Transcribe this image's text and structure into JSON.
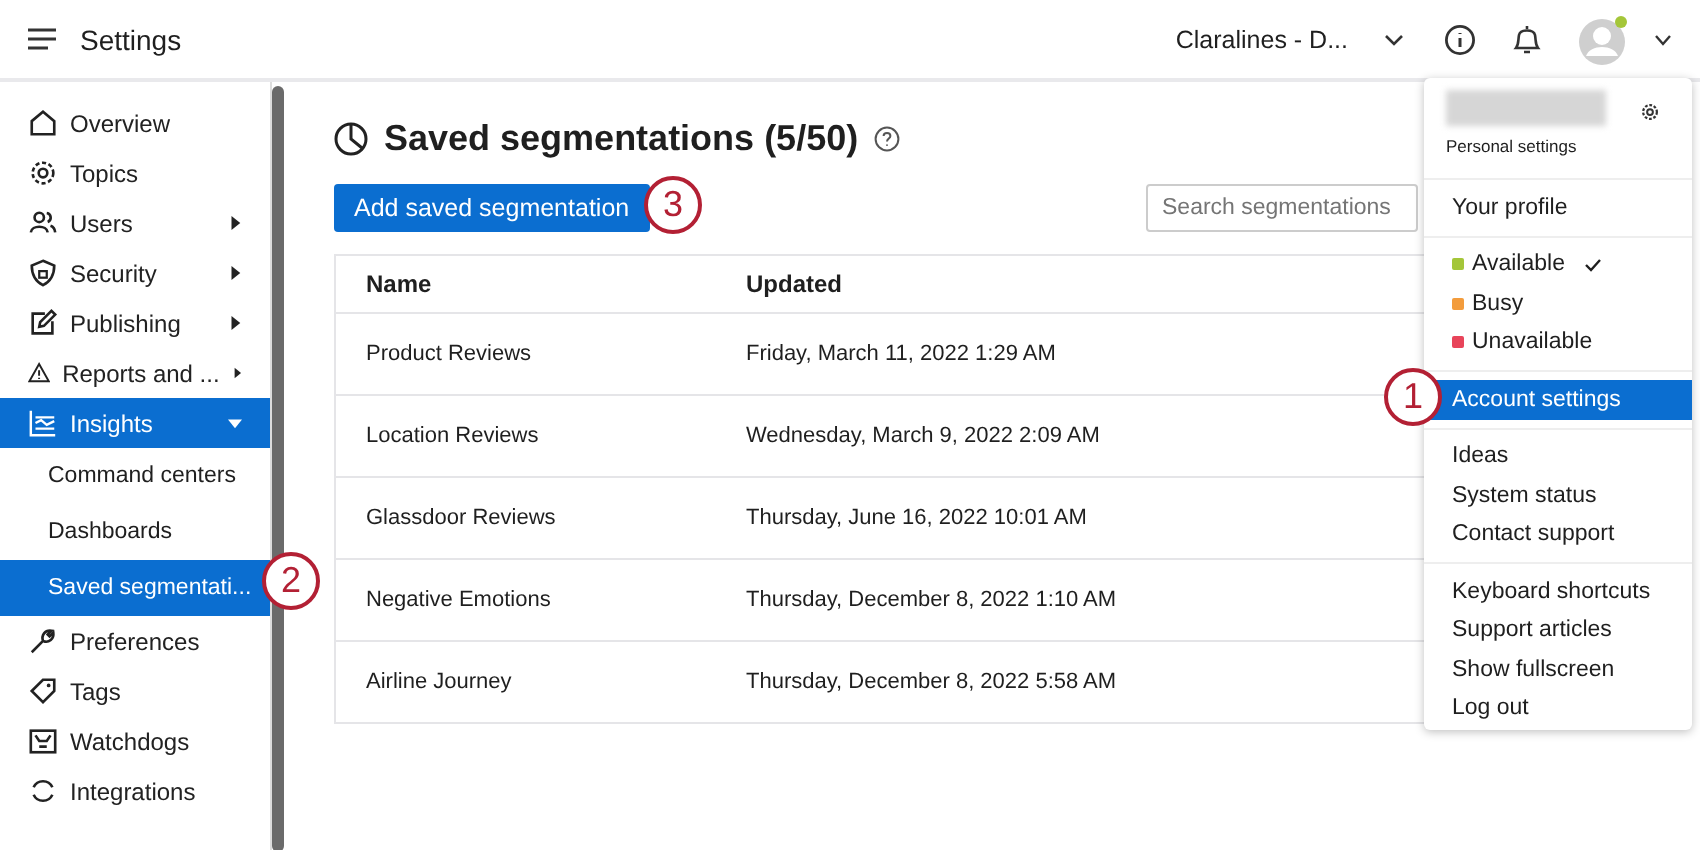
{
  "top_bar": {
    "title": "Settings",
    "account_selector": "Claralines - D..."
  },
  "sidebar": {
    "items": [
      {
        "label": "Overview",
        "selected": false
      },
      {
        "label": "Topics",
        "selected": false
      },
      {
        "label": "Users",
        "selected": false,
        "expanded": false
      },
      {
        "label": "Security",
        "selected": false,
        "expanded": false
      },
      {
        "label": "Publishing",
        "selected": false,
        "expanded": false
      },
      {
        "label": "Reports and ...",
        "selected": false,
        "expanded": false
      },
      {
        "label": "Insights",
        "selected": true,
        "expanded": true,
        "children": [
          {
            "label": "Command centers",
            "selected": false
          },
          {
            "label": "Dashboards",
            "selected": false
          },
          {
            "label": "Saved segmentati...",
            "selected": true
          }
        ]
      },
      {
        "label": "Preferences",
        "selected": false
      },
      {
        "label": "Tags",
        "selected": false
      },
      {
        "label": "Watchdogs",
        "selected": false
      },
      {
        "label": "Integrations",
        "selected": false
      }
    ]
  },
  "main": {
    "title": "Saved segmentations (5/50)",
    "add_button": "Add saved segmentation",
    "search": {
      "placeholder": "Search segmentations"
    },
    "table": {
      "columns": [
        "Name",
        "Updated"
      ],
      "rows": [
        [
          "Product Reviews",
          "Friday, March 11, 2022 1:29 AM"
        ],
        [
          "Location Reviews",
          "Wednesday, March 9, 2022 2:09 AM"
        ],
        [
          "Glassdoor Reviews",
          "Thursday, June 16, 2022 10:01 AM"
        ],
        [
          "Negative Emotions",
          "Thursday, December 8, 2022 1:10 AM"
        ],
        [
          "Airline Journey",
          "Thursday, December 8, 2022 5:58 AM"
        ]
      ]
    }
  },
  "account_menu": {
    "personal_settings": "Personal settings",
    "sections": [
      [
        {
          "label": "Your profile",
          "kind": "link",
          "selected": false
        }
      ],
      [
        {
          "label": "Available",
          "kind": "status",
          "color": "#a4c639",
          "checked": true
        },
        {
          "label": "Busy",
          "kind": "status",
          "color": "#f39c3c",
          "checked": false
        },
        {
          "label": "Unavailable",
          "kind": "status",
          "color": "#e8445a",
          "checked": false
        }
      ],
      [
        {
          "label": "Account settings",
          "kind": "link",
          "selected": true
        }
      ],
      [
        {
          "label": "Ideas",
          "kind": "link",
          "selected": false
        },
        {
          "label": "System status",
          "kind": "link",
          "selected": false
        },
        {
          "label": "Contact support",
          "kind": "link",
          "selected": false
        }
      ],
      [
        {
          "label": "Keyboard shortcuts",
          "kind": "link",
          "selected": false
        },
        {
          "label": "Support articles",
          "kind": "link",
          "selected": false
        },
        {
          "label": "Show fullscreen",
          "kind": "link",
          "selected": false
        },
        {
          "label": "Log out",
          "kind": "link",
          "selected": false
        }
      ]
    ]
  },
  "callouts": [
    {
      "number": "1"
    },
    {
      "number": "2"
    },
    {
      "number": "3"
    }
  ]
}
